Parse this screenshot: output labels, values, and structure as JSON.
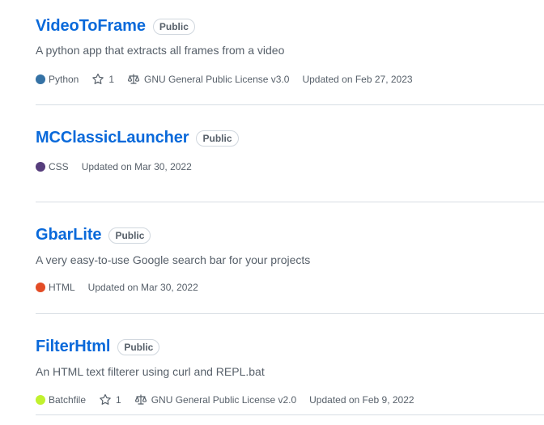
{
  "repos": [
    {
      "name": "VideoToFrame",
      "visibility": "Public",
      "description": "A python app that extracts all frames from a video",
      "language": "Python",
      "language_color": "#3572A5",
      "stars": "1",
      "license": "GNU General Public License v3.0",
      "updated": "Updated on Feb 27, 2023"
    },
    {
      "name": "MCClassicLauncher",
      "visibility": "Public",
      "language": "CSS",
      "language_color": "#563d7c",
      "updated": "Updated on Mar 30, 2022"
    },
    {
      "name": "GbarLite",
      "visibility": "Public",
      "description": "A very easy-to-use Google search bar for your projects",
      "language": "HTML",
      "language_color": "#e34c26",
      "updated": "Updated on Mar 30, 2022"
    },
    {
      "name": "FilterHtml",
      "visibility": "Public",
      "description": "An HTML text filterer using curl and REPL.bat",
      "language": "Batchfile",
      "language_color": "#C1F12E",
      "stars": "1",
      "license": "GNU General Public License v2.0",
      "updated": "Updated on Feb 9, 2022"
    }
  ]
}
